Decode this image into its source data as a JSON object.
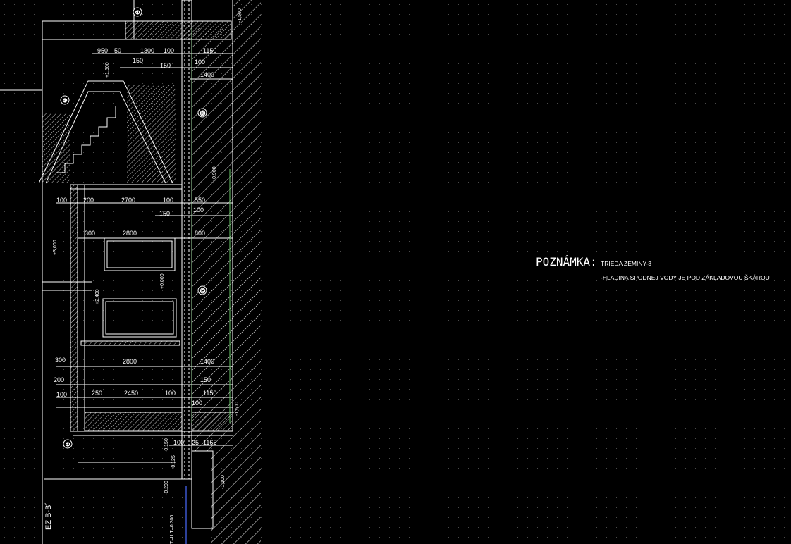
{
  "note": {
    "title": "POZNÁMKA:",
    "line1": "TRIEDA ZEMINY-3",
    "line2": "-HLADINA SPODNEJ VODY JE POD ZÁKLADOVOU ŠKÁROU"
  },
  "section_label": "EZ B-B´",
  "bottom_level": "T=U.T=0,300",
  "axis_marks": [
    "①",
    "①",
    "②",
    "Ⓒ",
    "Ⓒ"
  ],
  "dimensions": {
    "top_row": [
      "950",
      "50",
      "1300",
      "100",
      "1150"
    ],
    "row2": [
      "150",
      "150",
      "100",
      "1400"
    ],
    "mid_row": [
      "100",
      "200",
      "2700",
      "100",
      "550"
    ],
    "row4": [
      "150",
      "100"
    ],
    "row5": [
      "300",
      "2800",
      "800"
    ],
    "row6": [
      "300",
      "2800",
      "1400"
    ],
    "row7": [
      "200",
      "150"
    ],
    "row8": [
      "100",
      "250",
      "2450",
      "100",
      "1150"
    ],
    "row9": [
      "100"
    ],
    "bottom_row": [
      "100",
      "25",
      "1165"
    ]
  },
  "levels": [
    "-1,500",
    "+1,500",
    "+3,000",
    "+2,400",
    "+0,000",
    "+0,900",
    "-1,500",
    "-0,150",
    "-0,200",
    "-1,100",
    "-0,125"
  ],
  "colors": {
    "background": "#000000",
    "lines": "#ffffff",
    "grid": "#3a3a3a",
    "accent_green": "#6ecb6e",
    "accent_blue": "#4a6cff"
  }
}
